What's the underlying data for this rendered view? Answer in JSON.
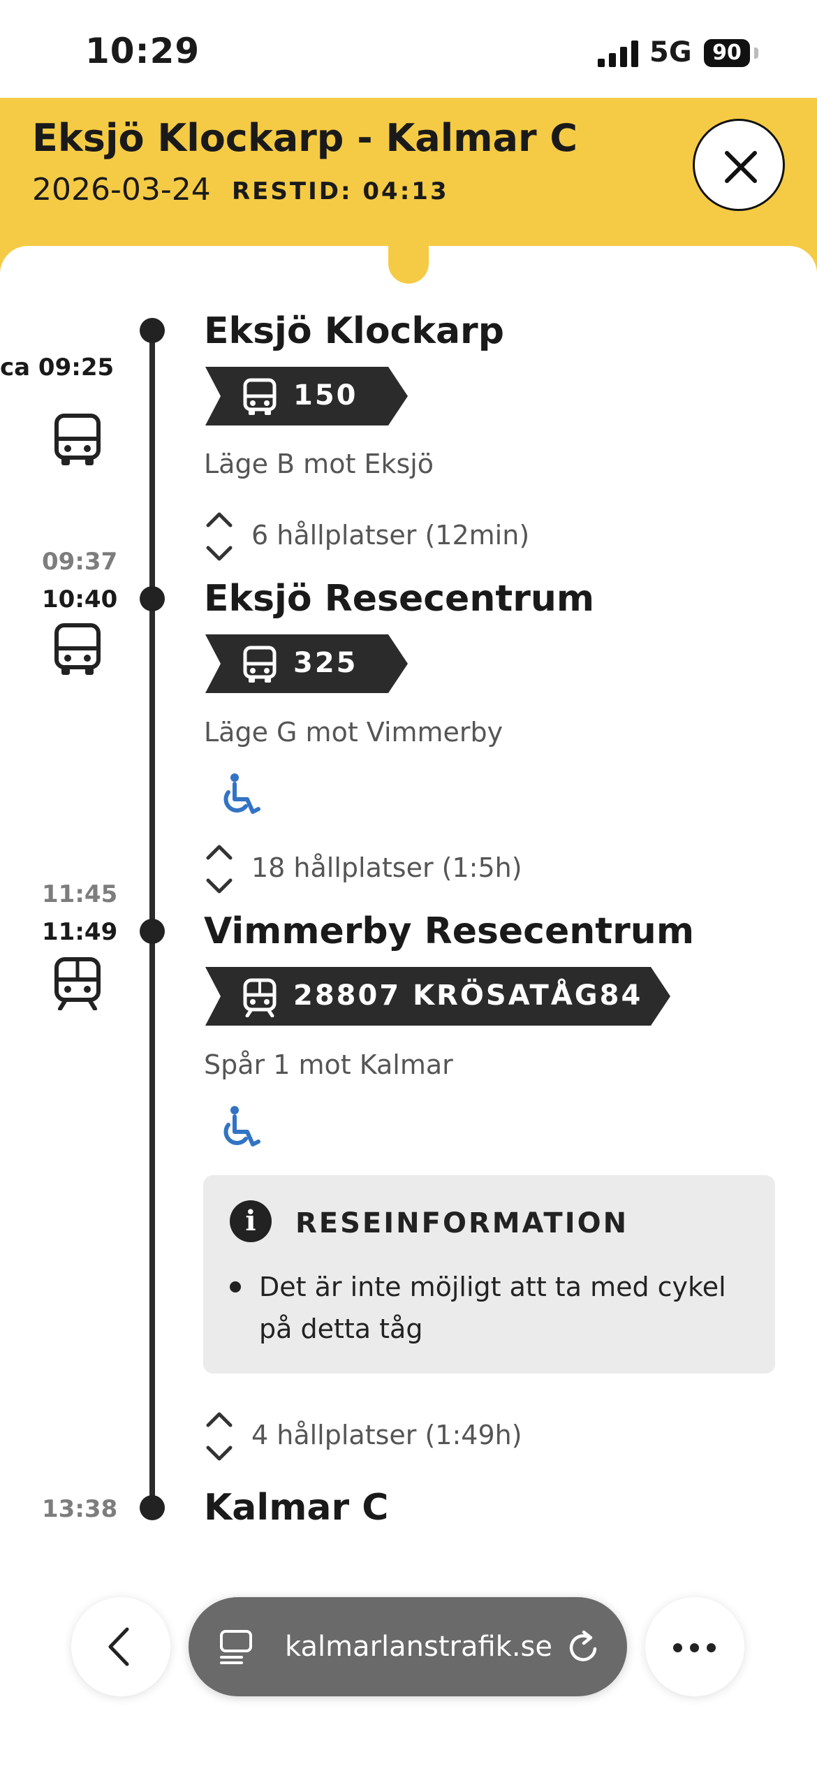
{
  "status_bar": {
    "time": "10:29",
    "network": "5G",
    "battery": "90"
  },
  "header": {
    "title": "Eksjö Klockarp - Kalmar C",
    "date": "2026-03-24",
    "travel_time": "RESTID: 04:13"
  },
  "stops": [
    {
      "name": "Eksjö Klockarp",
      "departure": "ca 09:25"
    },
    {
      "name": "Eksjö Resecentrum",
      "arrival": "09:37",
      "departure": "10:40"
    },
    {
      "name": "Vimmerby Resecentrum",
      "arrival": "11:45",
      "departure": "11:49"
    },
    {
      "name": "Kalmar C",
      "arrival": "13:38"
    }
  ],
  "legs": [
    {
      "mode": "bus-icon",
      "line": "150",
      "platform": "Läge B mot Eksjö",
      "stops_summary": "6 hållplatser (12min)"
    },
    {
      "mode": "bus-icon",
      "line": "325",
      "platform": "Läge G mot Vimmerby",
      "accessible": true,
      "stops_summary": "18 hållplatser (1:5h)"
    },
    {
      "mode": "train-icon",
      "line": "28807 KRÖSATÅG84",
      "platform": "Spår 1 mot Kalmar",
      "accessible": true,
      "stops_summary": "4 hållplatser (1:49h)"
    }
  ],
  "travel_info": {
    "title": "RESEINFORMATION",
    "items": [
      "Det är inte möjligt att ta med cykel på detta tåg"
    ]
  },
  "browser": {
    "url": "kalmarlanstrafik.se"
  },
  "colors": {
    "header_bg": "#f5cb45",
    "badge_bg": "#2b2b2b",
    "accessibility_blue": "#3273c4",
    "info_bg": "#ebebeb"
  }
}
